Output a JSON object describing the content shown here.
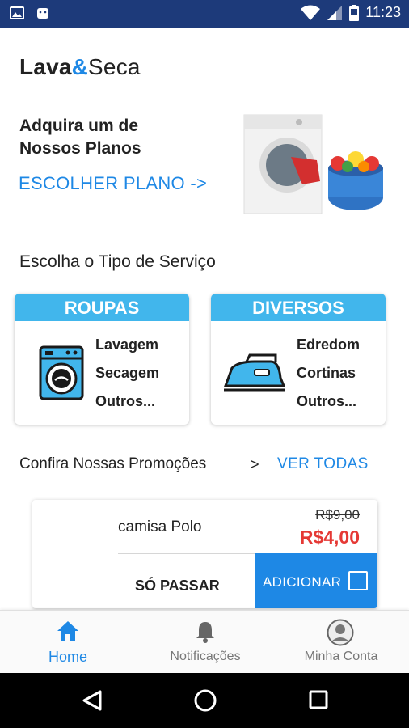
{
  "status_bar": {
    "time": "11:23"
  },
  "brand": {
    "name_bold": "Lava",
    "ampersand": "&",
    "name_light": "Seca"
  },
  "plans": {
    "title_line1": "Adquira um de",
    "title_line2": "Nossos Planos",
    "link": "ESCOLHER PLANO  ->"
  },
  "services": {
    "title": "Escolha o Tipo de Serviço",
    "cards": [
      {
        "header": "ROUPAS",
        "items": [
          "Lavagem",
          "Secagem",
          "Outros..."
        ],
        "icon": "washing-machine-icon"
      },
      {
        "header": "DIVERSOS",
        "items": [
          "Edredom",
          "Cortinas",
          "Outros..."
        ],
        "icon": "iron-icon"
      }
    ]
  },
  "promotions": {
    "title": "Confira Nossas Promoções",
    "arrow": ">",
    "see_all": "VER TODAS",
    "item": {
      "name": "camisa Polo",
      "old_price": "R$9,00",
      "new_price": "R$4,00",
      "service": "SÓ PASSAR",
      "add_label": "ADICIONAR"
    }
  },
  "bottom_nav": [
    {
      "label": "Home",
      "icon": "home-icon",
      "active": true
    },
    {
      "label": "Notificações",
      "icon": "bell-icon",
      "active": false
    },
    {
      "label": "Minha Conta",
      "icon": "account-icon",
      "active": false
    }
  ],
  "colors": {
    "accent": "#1e88e5",
    "card_header": "#41b6ec",
    "price": "#e53935",
    "status_bar": "#1d3a7a"
  }
}
